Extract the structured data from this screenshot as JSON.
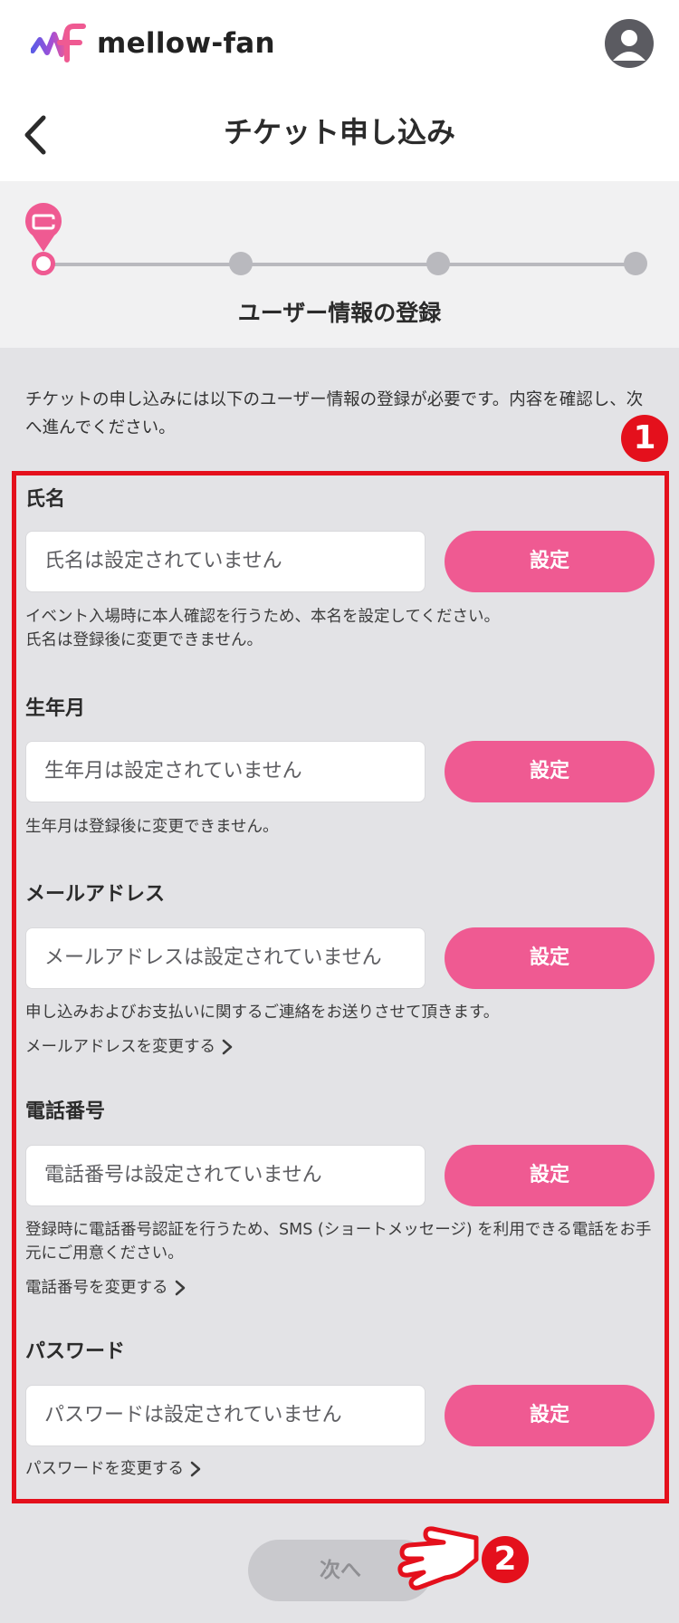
{
  "header": {
    "brand": "mellow-fan"
  },
  "titlebar": {
    "title": "チケット申し込み"
  },
  "stepper": {
    "current_step_label": "ユーザー情報の登録",
    "total_steps": 4,
    "current_step": 1
  },
  "intro": {
    "text": "チケットの申し込みには以下のユーザー情報の登録が必要です。内容を確認し、次へ進んでください。"
  },
  "markers": {
    "first": "1",
    "second": "2"
  },
  "sections": [
    {
      "label": "氏名",
      "value": "氏名は設定されていません",
      "button": "設定",
      "note": "イベント入場時に本人確認を行うため、本名を設定してください。\n氏名は登録後に変更できません。"
    },
    {
      "label": "生年月",
      "value": "生年月は設定されていません",
      "button": "設定",
      "note": "生年月は登録後に変更できません。"
    },
    {
      "label": "メールアドレス",
      "value": "メールアドレスは設定されていません",
      "button": "設定",
      "note": "申し込みおよびお支払いに関するご連絡をお送りさせて頂きます。",
      "link": "メールアドレスを変更する"
    },
    {
      "label": "電話番号",
      "value": "電話番号は設定されていません",
      "button": "設定",
      "note": "登録時に電話番号認証を行うため、SMS (ショートメッセージ) を利用できる電話をお手元にご用意ください。",
      "link": "電話番号を変更する"
    },
    {
      "label": "パスワード",
      "value": "パスワードは設定されていません",
      "button": "設定",
      "link": "パスワードを変更する"
    }
  ],
  "footer": {
    "next_label": "次へ"
  },
  "colors": {
    "accent": "#ef5a92",
    "annotation": "#e4101c",
    "background": "#e3e3e6"
  }
}
